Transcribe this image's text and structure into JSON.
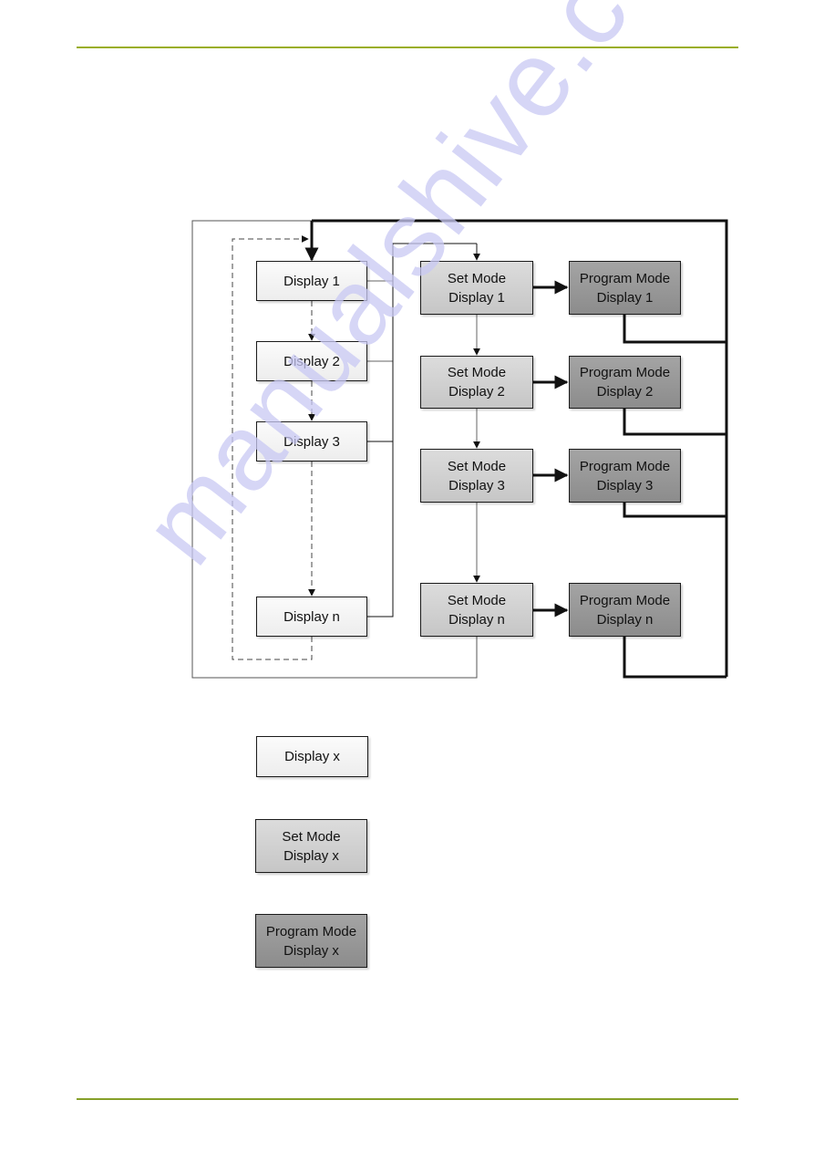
{
  "page": {
    "accent_color": "#9aae1e",
    "watermark_text": "manualshive.com",
    "watermark_color": "#c9c9f4"
  },
  "diagram": {
    "display_column": [
      {
        "label": "Display 1"
      },
      {
        "label": "Display 2"
      },
      {
        "label": "Display 3"
      },
      {
        "label": "Display n"
      }
    ],
    "set_mode_column": [
      {
        "line1": "Set Mode",
        "line2": "Display 1"
      },
      {
        "line1": "Set Mode",
        "line2": "Display 2"
      },
      {
        "line1": "Set Mode",
        "line2": "Display 3"
      },
      {
        "line1": "Set Mode",
        "line2": "Display n"
      }
    ],
    "program_mode_column": [
      {
        "line1": "Program Mode",
        "line2": "Display 1"
      },
      {
        "line1": "Program Mode",
        "line2": "Display 2"
      },
      {
        "line1": "Program Mode",
        "line2": "Display 3"
      },
      {
        "line1": "Program Mode",
        "line2": "Display n"
      }
    ],
    "colors": {
      "display_fill": "#f4f4f4",
      "set_mode_fill": "#d0d0d0",
      "program_mode_fill": "#989898",
      "line": "#1a1a1a"
    }
  },
  "legend": {
    "display": {
      "label": "Display x"
    },
    "set_mode": {
      "line1": "Set Mode",
      "line2": "Display x"
    },
    "program_mode": {
      "line1": "Program Mode",
      "line2": "Display x"
    }
  }
}
